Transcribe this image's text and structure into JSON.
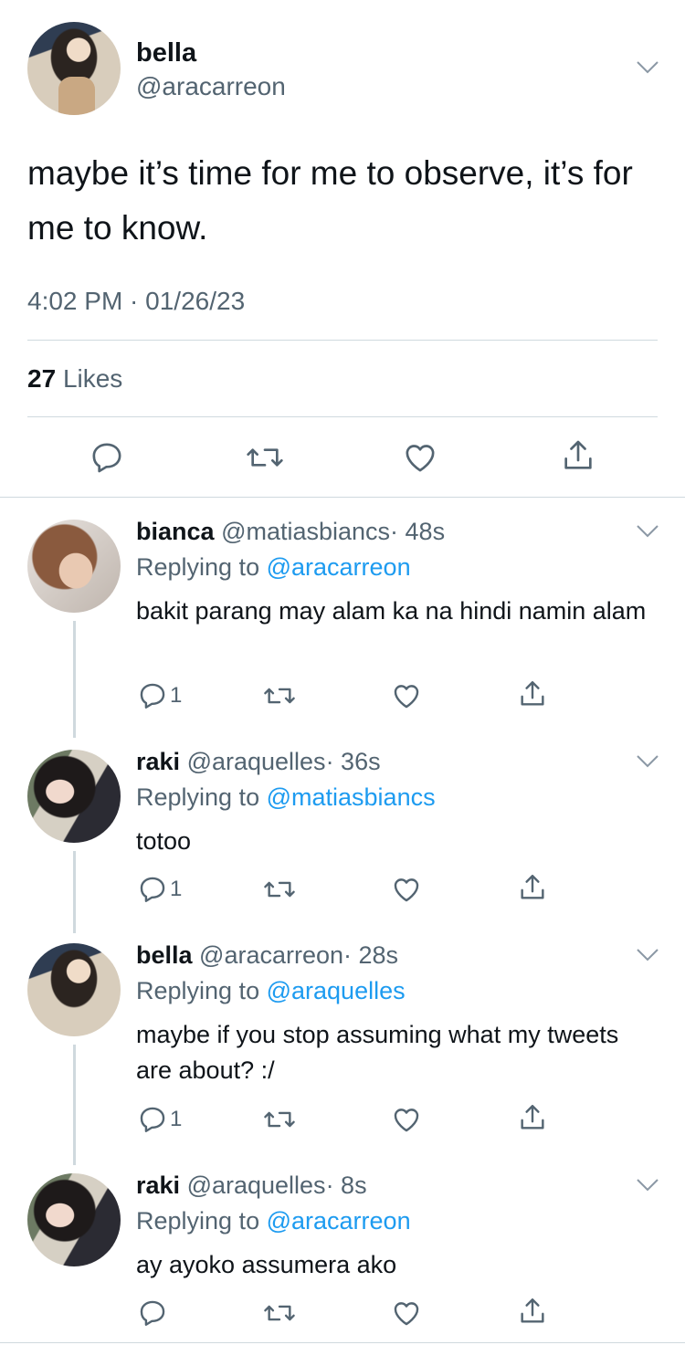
{
  "main": {
    "name": "bella",
    "handle": "@aracarreon",
    "text": "maybe it’s time for me to observe, it’s for me to know.",
    "timestamp": "4:02 PM · 01/26/23",
    "likes_count": "27",
    "likes_label": "Likes"
  },
  "replies": [
    {
      "name": "bianca",
      "handle": "@matiasbiancs",
      "time": "· 48s",
      "replying_label": "Replying to",
      "replying_to": "@aracarreon",
      "text": "bakit parang may alam ka na hindi namin alam",
      "reply_count": "1"
    },
    {
      "name": "raki",
      "handle": "@araquelles",
      "time": "· 36s",
      "replying_label": "Replying to",
      "replying_to": "@matiasbiancs",
      "text": "totoo",
      "reply_count": "1"
    },
    {
      "name": "bella",
      "handle": "@aracarreon",
      "time": "· 28s",
      "replying_label": "Replying to",
      "replying_to": "@araquelles",
      "text": "maybe if you stop assuming what my tweets are about? :/",
      "reply_count": "1"
    },
    {
      "name": "raki",
      "handle": "@araquelles",
      "time": "· 8s",
      "replying_label": "Replying to",
      "replying_to": "@aracarreon",
      "text": "ay ayoko assumera ako",
      "reply_count": ""
    }
  ],
  "colors": {
    "text": "#0f1419",
    "secondary": "#536471",
    "link": "#1d9bf0",
    "divider": "#cfd9de"
  },
  "icons": [
    "chevron-down-icon",
    "reply-icon",
    "retweet-icon",
    "like-icon",
    "share-icon"
  ]
}
